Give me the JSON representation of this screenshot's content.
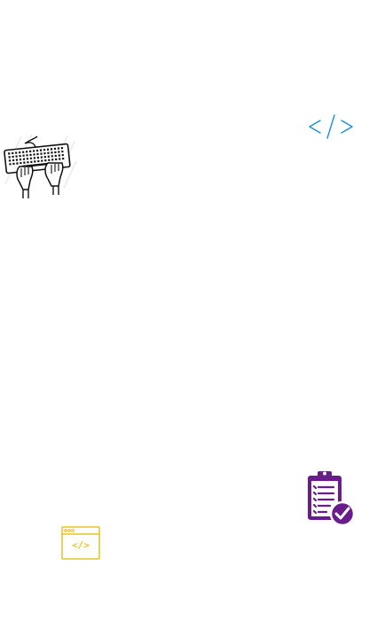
{
  "icons": [
    {
      "name": "keyboard-typing-hands-icon",
      "color": "#111111"
    },
    {
      "name": "code-tag-icon",
      "color": "#1b8fd8"
    },
    {
      "name": "clipboard-checklist-icon",
      "color": "#6a1b8c"
    },
    {
      "name": "code-window-icon",
      "color": "#e6b400"
    }
  ],
  "code_window": {
    "label": "</>"
  }
}
